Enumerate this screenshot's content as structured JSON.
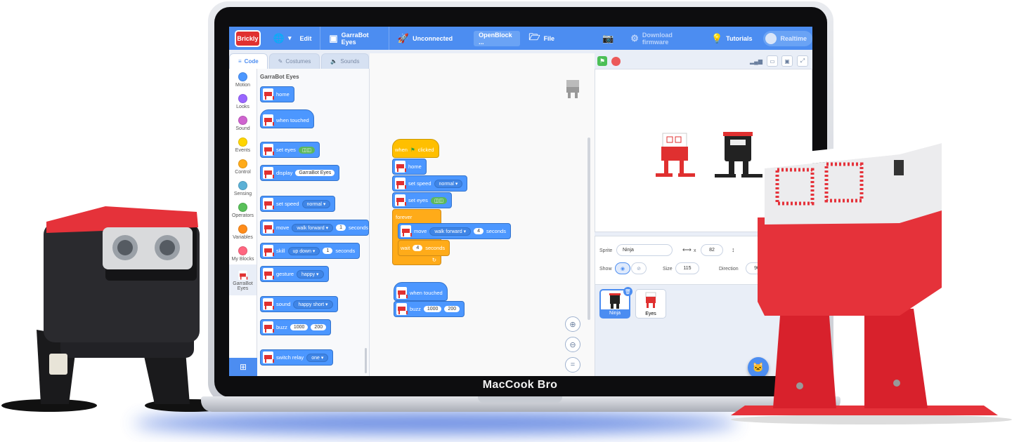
{
  "brand": "MacCook Bro",
  "menubar": {
    "logo": "Brickly",
    "language_icon": "globe-icon",
    "edit": "Edit",
    "robot": "GarraBot Eyes",
    "connection": "Unconnected",
    "project": "OpenBlock ...",
    "file": "File",
    "download": "Download firmware",
    "tutorials": "Tutorials",
    "realtime": "Realtime"
  },
  "tabs": {
    "code": "Code",
    "costumes": "Costumes",
    "sounds": "Sounds"
  },
  "categories": [
    {
      "label": "Motion",
      "color": "#4c97ff"
    },
    {
      "label": "Looks",
      "color": "#9966ff"
    },
    {
      "label": "Sound",
      "color": "#cf63cf"
    },
    {
      "label": "Events",
      "color": "#ffd500"
    },
    {
      "label": "Control",
      "color": "#ffab19"
    },
    {
      "label": "Sensing",
      "color": "#5cb1d6"
    },
    {
      "label": "Operators",
      "color": "#59c059"
    },
    {
      "label": "Variables",
      "color": "#ff8c1a"
    },
    {
      "label": "My Blocks",
      "color": "#ff6680"
    }
  ],
  "robot_category": {
    "line1": "GarraBot",
    "line2": "Eyes"
  },
  "palette": {
    "title": "GarraBot Eyes",
    "home": "home",
    "when_touched": "when touched",
    "set_eyes": "set eyes",
    "display": "display",
    "display_value": "GarraBot Eyes",
    "set_speed": "set speed",
    "speed_value": "normal",
    "move": "move",
    "move_value": "walk forward",
    "move_num": "1",
    "move_unit": "seconds",
    "skill": "skill",
    "skill_value": "up down",
    "skill_num": "1",
    "skill_unit": "seconds",
    "gesture": "gesture",
    "gesture_value": "happy",
    "sound": "sound",
    "sound_value": "happy short",
    "buzz": "buzz",
    "buzz_a": "1000",
    "buzz_b": "200",
    "relay": "switch relay",
    "relay_value": "one"
  },
  "script": {
    "when": "when",
    "clicked": "clicked",
    "home": "home",
    "set_speed": "set speed",
    "speed_value": "normal",
    "set_eyes": "set eyes",
    "forever": "forever",
    "move": "move",
    "move_value": "walk forward",
    "move_num": "4",
    "move_unit": "seconds",
    "wait": "wait",
    "wait_num": "4",
    "wait_unit": "seconds",
    "when_touched": "when touched",
    "buzz": "buzz",
    "buzz_a": "1000",
    "buzz_b": "200"
  },
  "sprite_info": {
    "sprite_label": "Sprite",
    "sprite_name": "Ninja",
    "x_label": "x",
    "x_value": "82",
    "show_label": "Show",
    "size_label": "Size",
    "size_value": "115",
    "direction_label": "Direction",
    "direction_value": "90"
  },
  "sprites": [
    {
      "name": "Ninja",
      "selected": true
    },
    {
      "name": "Eyes",
      "selected": false
    }
  ]
}
